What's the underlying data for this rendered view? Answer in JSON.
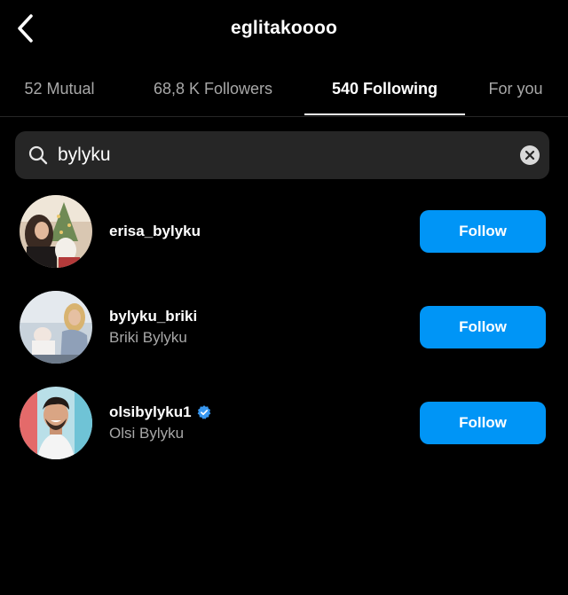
{
  "header": {
    "title": "eglitakoooo",
    "back_icon": "chevron-left-icon"
  },
  "tabs": [
    {
      "label": "52 Mutual",
      "active": false
    },
    {
      "label": "68,8 K Followers",
      "active": false
    },
    {
      "label": "540 Following",
      "active": true
    },
    {
      "label": "For you",
      "active": false
    }
  ],
  "search": {
    "value": "bylyku",
    "icon": "search-icon",
    "clear_icon": "clear-icon"
  },
  "users": [
    {
      "username": "erisa_bylyku",
      "fullname": "",
      "verified": false,
      "button": "Follow"
    },
    {
      "username": "bylyku_briki",
      "fullname": "Briki Bylyku",
      "verified": false,
      "button": "Follow"
    },
    {
      "username": "olsibylyku1",
      "fullname": "Olsi Bylyku",
      "verified": true,
      "button": "Follow"
    }
  ],
  "colors": {
    "background": "#000000",
    "follow_button": "#0095f6",
    "search_field": "#262626",
    "secondary_text": "#a8a8a8",
    "verified_badge": "#3897f0"
  }
}
